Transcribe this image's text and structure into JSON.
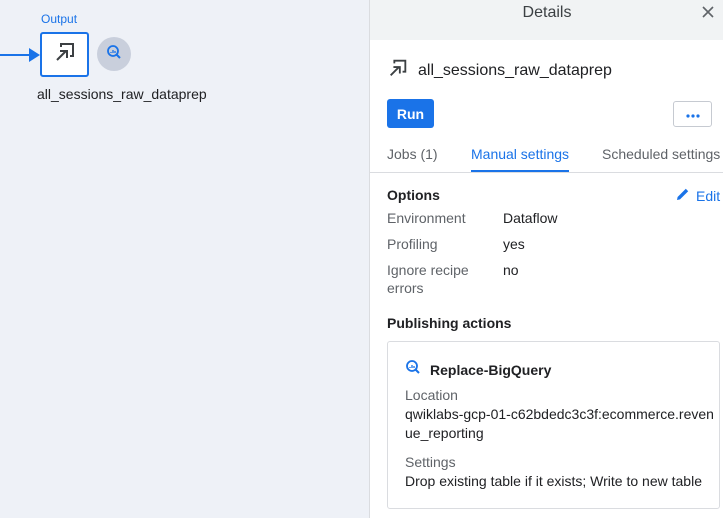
{
  "canvas": {
    "node_type_label": "Output",
    "node_name": "all_sessions_raw_dataprep",
    "node_icon": "output-arrow-icon",
    "destination_icon": "bigquery-icon",
    "accent_color": "#1a73e8"
  },
  "panel": {
    "title": "Details",
    "close_icon": "close-icon",
    "output_name": "all_sessions_raw_dataprep",
    "run_label": "Run",
    "more_icon": "more-horizontal-icon",
    "tabs": [
      {
        "label": "Jobs (1)",
        "active": false
      },
      {
        "label": "Manual settings",
        "active": true
      },
      {
        "label": "Scheduled settings",
        "active": false
      }
    ],
    "options": {
      "title": "Options",
      "edit_label": "Edit",
      "rows": [
        {
          "label": "Environment",
          "value": "Dataflow"
        },
        {
          "label": "Profiling",
          "value": "yes"
        },
        {
          "label": "Ignore recipe errors",
          "value": "no"
        }
      ]
    },
    "publishing": {
      "title": "Publishing actions",
      "action": {
        "name": "Replace-BigQuery",
        "location_label": "Location",
        "location_value": "qwiklabs-gcp-01-c62bdedc3c3f:ecommerce.revenue_reporting",
        "settings_label": "Settings",
        "settings_value": "Drop existing table if it exists; Write to new table"
      }
    }
  }
}
